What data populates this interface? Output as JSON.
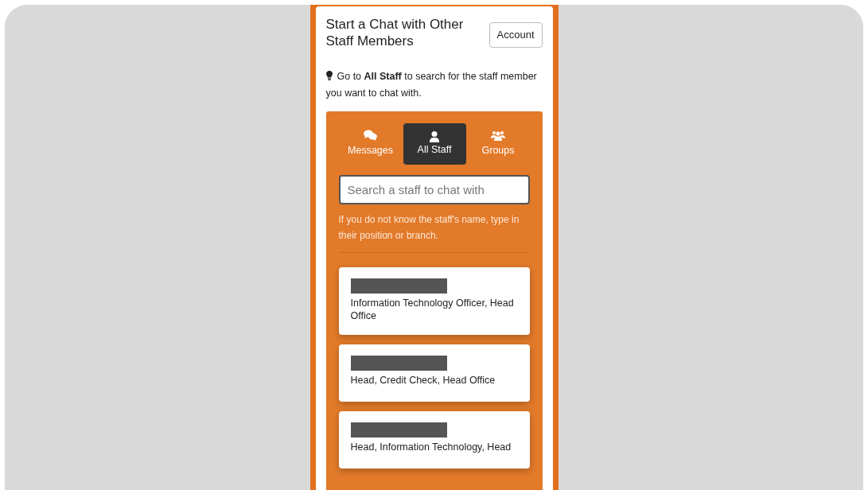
{
  "header": {
    "title": "Start a Chat with Other Staff Members",
    "account_button": "Account"
  },
  "hint": "Go to **All Staff** to search for the staff member you want to chat with.",
  "tabs": [
    {
      "label": "Messages",
      "kind": "messages",
      "selected": false
    },
    {
      "label": "All Staff",
      "kind": "staff",
      "selected": true
    },
    {
      "label": "Groups",
      "kind": "groups",
      "selected": false
    }
  ],
  "search": {
    "placeholder": "Search a staff to chat with"
  },
  "search_help": "If you do not know the staff's name, type in their position or branch.",
  "staff": [
    {
      "position": "Information Technology Officer, Head Office"
    },
    {
      "position": "Head, Credit Check, Head Office"
    },
    {
      "position": "Head, Information Technology, Head"
    }
  ]
}
